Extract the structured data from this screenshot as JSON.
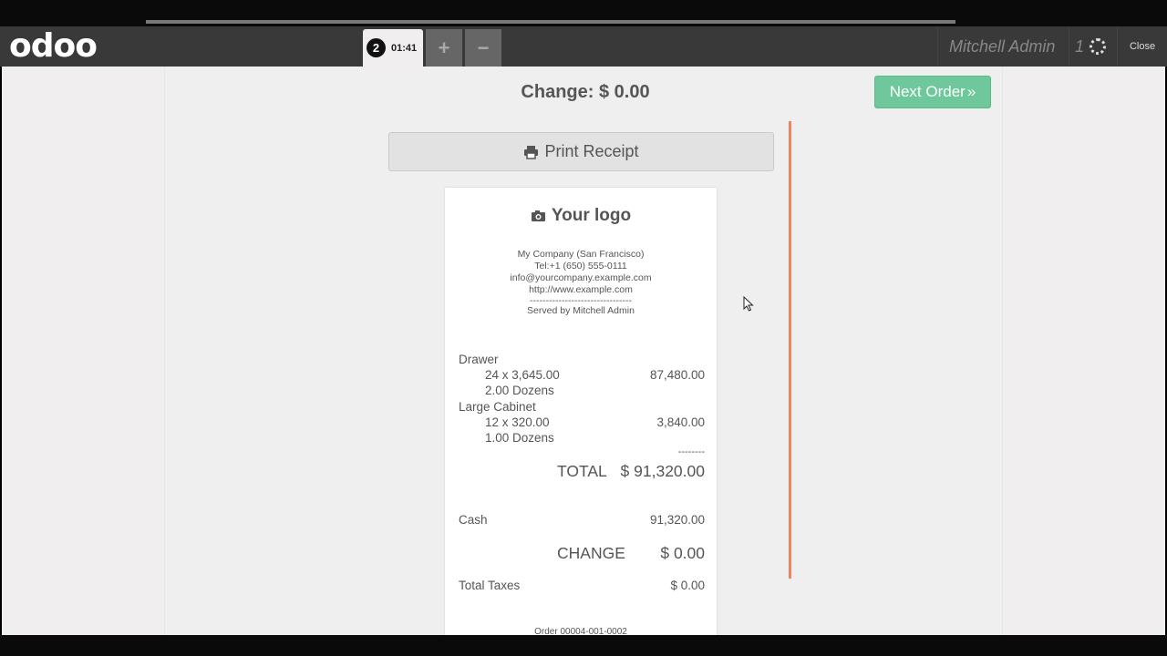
{
  "navbar": {
    "logo": "odoo",
    "order_tab": {
      "number": "2",
      "time": "01:41"
    },
    "add_order": "+",
    "remove_order": "−",
    "user": "Mitchell Admin",
    "sync_count": "1",
    "close": "Close"
  },
  "screen": {
    "change_label": "Change: $ 0.00",
    "next_order": "Next Order",
    "next_order_icon": "»",
    "print_receipt": "Print Receipt"
  },
  "receipt": {
    "logo": "Your logo",
    "company": "My Company (San Francisco)",
    "tel": "Tel:+1 (650) 555-0111",
    "email": "info@yourcompany.example.com",
    "website": "http://www.example.com",
    "separator": "--------------------------------",
    "served_by": "Served by Mitchell Admin",
    "lines": [
      {
        "product": "Drawer",
        "qty_price": "24 x 3,645.00",
        "amount": "87,480.00",
        "uom": "2.00 Dozens"
      },
      {
        "product": "Large Cabinet",
        "qty_price": "12 x 320.00",
        "amount": "3,840.00",
        "uom": "1.00 Dozens"
      }
    ],
    "total_separator": "--------",
    "total_label": "TOTAL",
    "total_value": "$ 91,320.00",
    "payment_method": "Cash",
    "payment_value": "91,320.00",
    "change_label": "CHANGE",
    "change_value": "$ 0.00",
    "taxes_label": "Total Taxes",
    "taxes_value": "$ 0.00",
    "order_ref": "Order 00004-001-0002"
  },
  "colors": {
    "navbar": "#393939",
    "next_order": "#6ec89b",
    "scroll_accent": "#f0845e"
  },
  "icons": {
    "print": "printer-icon",
    "camera": "camera-icon",
    "spinner": "spinner-icon"
  }
}
